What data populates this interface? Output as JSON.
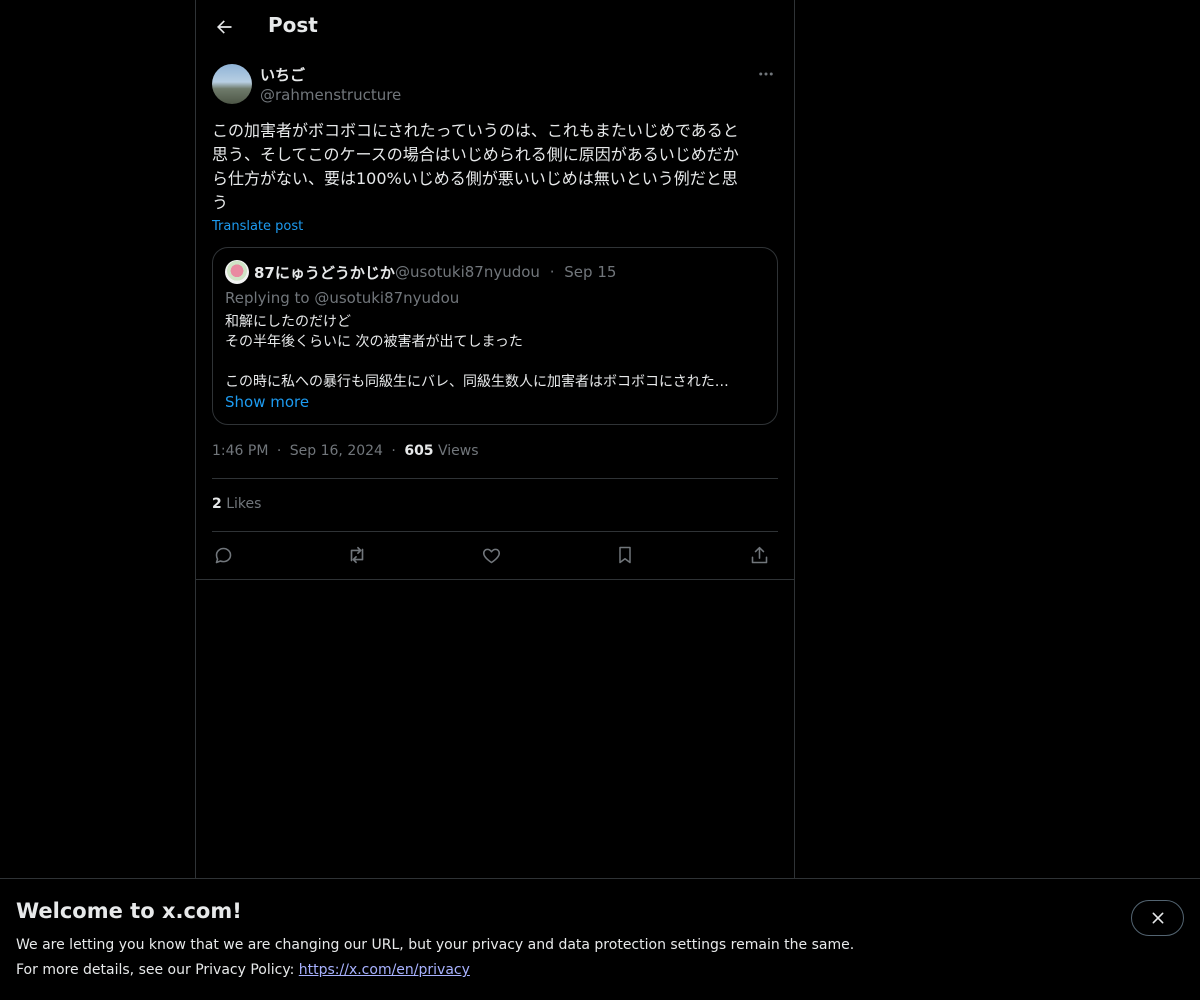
{
  "header": {
    "title": "Post",
    "back_icon": "arrow-left-icon"
  },
  "post": {
    "author": {
      "name": "いちご",
      "handle": "@rahmenstructure"
    },
    "text_lines": [
      "この加害者がボコボコにされたっていうのは、これもまたいじめであると",
      "思う、そしてこのケースの場合はいじめられる側に原因があるいじめだか",
      "ら仕方がない、要は100%いじめる側が悪いいじめは無いという例だと思",
      "う"
    ],
    "translate_label": "Translate post",
    "quote": {
      "name": "87にゅうどうかじか",
      "handle": "@usotuki87nyudou",
      "separator": "·",
      "date": "Sep 15",
      "replying_to": "Replying to @usotuki87nyudou",
      "text_lines": [
        "和解にしたのだけど",
        "その半年後くらいに 次の被害者が出てしまった",
        "",
        "この時に私への暴行も同級生にバレ、同級生数人に加害者はボコボコにされた…"
      ],
      "show_more": "Show more"
    },
    "time": "1:46 PM",
    "sep": "·",
    "date": "Sep 16, 2024",
    "views_count": "605",
    "views_label": "Views",
    "likes_count": "2",
    "likes_label": "Likes"
  },
  "actions": [
    {
      "icon": "reply-icon"
    },
    {
      "icon": "retweet-icon"
    },
    {
      "icon": "like-heart-icon"
    },
    {
      "icon": "bookmark-icon"
    },
    {
      "icon": "share-icon"
    }
  ],
  "banner": {
    "title": "Welcome to x.com!",
    "line1": "We are letting you know that we are changing our URL, but your privacy and data protection settings remain the same.",
    "line2_prefix": "For more details, see our Privacy Policy: ",
    "link": "https://x.com/en/privacy"
  },
  "colors": {
    "accent": "#1d9bf0",
    "muted": "#71767b",
    "text": "#e7e9ea",
    "border": "#2f3336",
    "link": "#a8b2ff"
  }
}
